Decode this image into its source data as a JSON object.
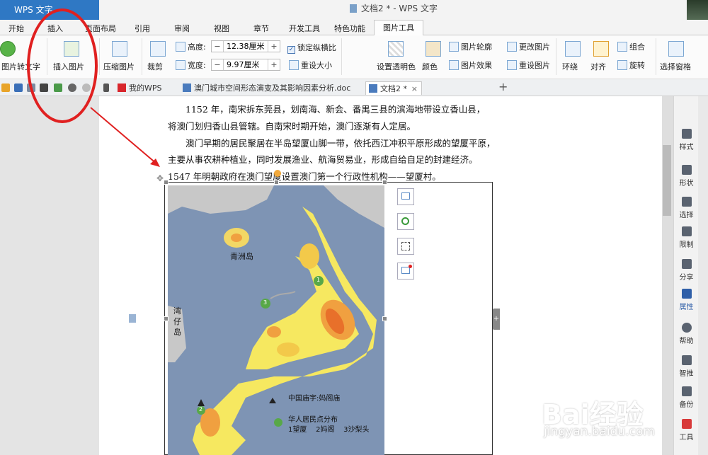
{
  "app": {
    "name": "WPS 文字",
    "window_title": "文档2 * - WPS 文字"
  },
  "tabs": [
    "开始",
    "插入",
    "页面布局",
    "引用",
    "审阅",
    "视图",
    "章节",
    "开发工具",
    "特色功能",
    "图片工具"
  ],
  "ribbon": {
    "img_to_text": "图片转文字",
    "insert_picture": "插入图片",
    "compress": "压缩图片",
    "crop": "裁剪",
    "height_label": "高度:",
    "height_value": "12.38厘米",
    "width_label": "宽度:",
    "width_value": "9.97厘米",
    "lock_ratio": "锁定纵横比",
    "reset_size": "重设大小",
    "transparency": "设置透明色",
    "color": "颜色",
    "outline": "图片轮廓",
    "effect": "图片效果",
    "change_pic": "更改图片",
    "reset_pic": "重设图片",
    "wrap": "环绕",
    "align": "对齐",
    "group": "组合",
    "rotate": "旋转",
    "selection_pane": "选择窗格"
  },
  "doc_tabs": [
    "我的WPS",
    "澳门城市空间形态演变及其影响因素分析.doc",
    "文档2 *"
  ],
  "document": {
    "lines": [
      "1152 年，南宋拆东莞县，划南海、新会、番禺三县的滨海地带设立香山县，",
      "将澳门划归香山县管辖。自南宋时期开始，澳门逐渐有人定居。",
      "澳门早期的居民聚居在半岛望厦山脚一带，依托西江冲积平原形成的望厦平原，",
      "主要从事农耕种植业，同时发展渔业、航海贸易业，形成自给自足的封建经济。",
      "1547 年明朝政府在澳门望厦设置澳门第一个行政性机构——望厦村。"
    ]
  },
  "map": {
    "island_label": "青洲岛",
    "side_label": "湾仔岛",
    "legend_temple": "中国庙宇:妈阁庙",
    "legend_settlement": "华人居民点分布",
    "legend_items": "1望厦    2妈阁    3沙梨头",
    "marker_1": "1",
    "marker_2": "2",
    "marker_3": "3"
  },
  "right_panel": [
    "样式",
    "形状",
    "选择",
    "限制",
    "分享",
    "属性",
    "帮助",
    "智推",
    "备份",
    "工具"
  ],
  "watermark": {
    "main": "Bai经验",
    "url": "jingyan.baidu.com"
  },
  "colors": {
    "accent": "#2f78c4",
    "annotation": "#e02020",
    "map_sea": "#7e94b4",
    "land": "#c9c9c9"
  }
}
